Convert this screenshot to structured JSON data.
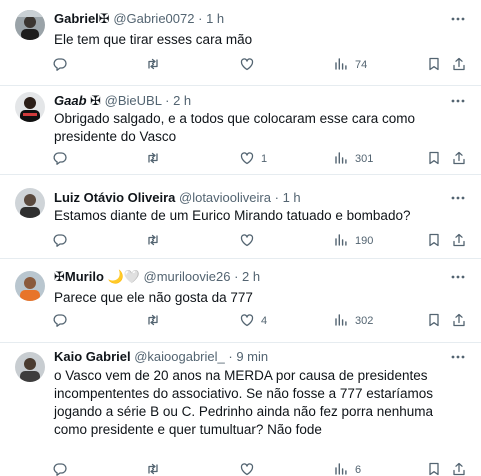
{
  "tweets": [
    {
      "name": "Gabriel",
      "badge": "✠",
      "emojis": "",
      "handle": "@Gabrie0072",
      "sep": "·",
      "time": "1 h",
      "text": "Ele tem que tirar esses cara mão",
      "replies": "",
      "retweets": "",
      "likes": "",
      "views": "74"
    },
    {
      "name": "Gaab",
      "badge": "✠",
      "emojis": "",
      "handle": "@BieUBL",
      "sep": "·",
      "time": "2 h",
      "text": "Obrigado salgado, e a todos que colocaram esse cara como presidente do Vasco",
      "replies": "",
      "retweets": "",
      "likes": "1",
      "views": "301"
    },
    {
      "name": "Luiz Otávio Oliveira",
      "badge": "",
      "emojis": "",
      "handle": "@lotaviooliveira",
      "sep": "·",
      "time": "1 h",
      "text": "Estamos diante de um Eurico Mirando tatuado e bombado?",
      "replies": "",
      "retweets": "",
      "likes": "",
      "views": "190"
    },
    {
      "name": "Murilo",
      "badge": "✠",
      "emojis": "🌙🤍",
      "handle": "@muriloovie26",
      "sep": "·",
      "time": "2 h",
      "text": "Parece que ele não gosta da 777",
      "replies": "",
      "retweets": "",
      "likes": "4",
      "views": "302"
    },
    {
      "name": "Kaio Gabriel",
      "badge": "",
      "emojis": "",
      "handle": "@kaioogabriel_",
      "sep": "·",
      "time": "9 min",
      "text": "o Vasco vem de 20 anos na MERDA por causa de presidentes incompententes do associativo. Se não fosse a 777 estaríamos jogando a série B ou C. Pedrinho ainda não fez porra nenhuma como presidente e quer tumultuar? Não fode",
      "replies": "",
      "retweets": "",
      "likes": "",
      "views": "6"
    }
  ],
  "colors": {
    "text": "#0f1419",
    "muted": "#536471",
    "divider": "#e6ecf0"
  },
  "icons": [
    "more-icon",
    "reply-icon",
    "retweet-icon",
    "like-icon",
    "views-icon",
    "bookmark-icon",
    "share-icon"
  ]
}
